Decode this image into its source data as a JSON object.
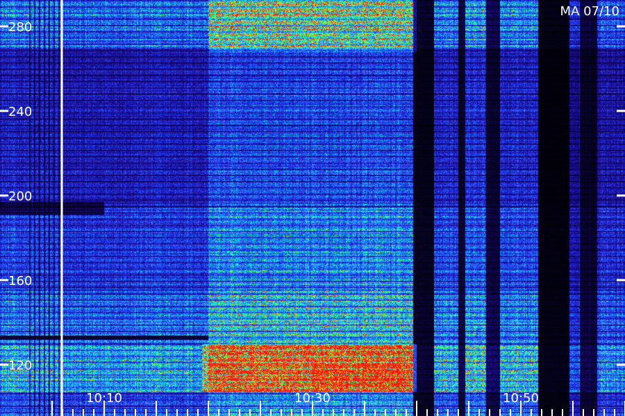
{
  "chart_data": {
    "type": "heatmap",
    "station_label": "MA 07/10",
    "y_axis": {
      "ticks": [
        280,
        240,
        200,
        160,
        120
      ],
      "range": [
        104,
        290
      ]
    },
    "x_axis": {
      "ticks": [
        "10:10",
        "10:30",
        "10:50"
      ],
      "range_minutes": [
        10.1,
        10.99
      ]
    },
    "colormap": [
      "#000000",
      "#1a0a8c",
      "#2a3cff",
      "#1ea0ff",
      "#18ffe0",
      "#3cff3c",
      "#f0ff10",
      "#ff8000",
      "#ff1010"
    ],
    "description_markers": {
      "vertical_marker_x_minute": "10:05"
    }
  }
}
